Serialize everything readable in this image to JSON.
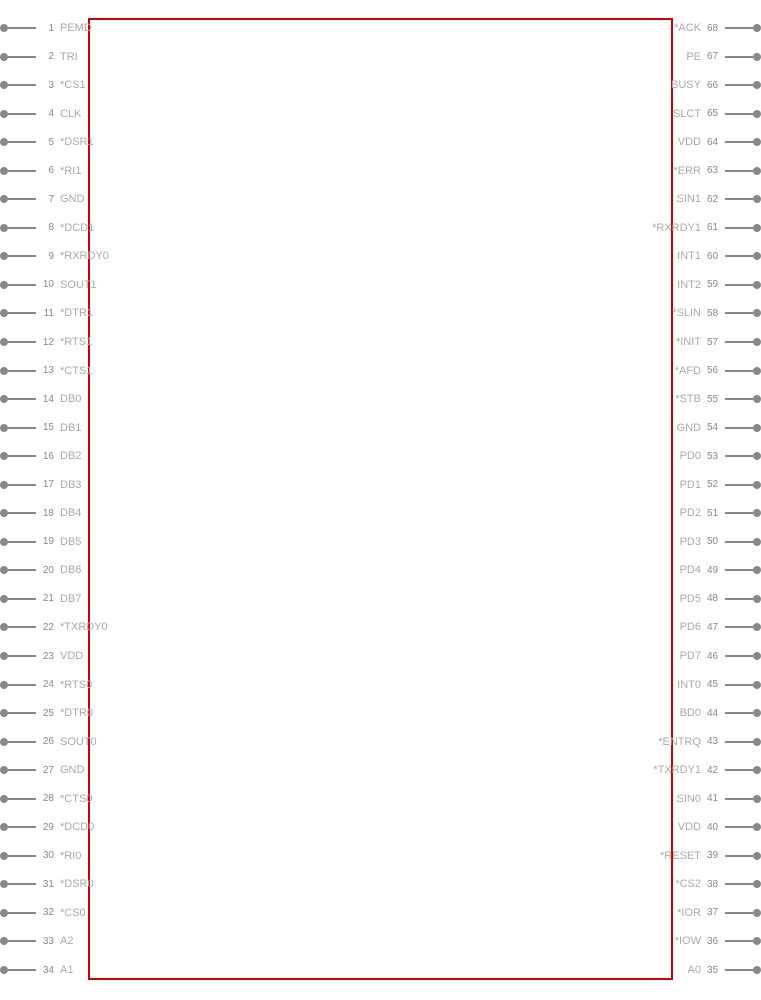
{
  "chip": {
    "left_pins": [
      {
        "num": "1",
        "label": "PEMD"
      },
      {
        "num": "2",
        "label": "TRI"
      },
      {
        "num": "3",
        "label": "*CS1"
      },
      {
        "num": "4",
        "label": "CLK"
      },
      {
        "num": "5",
        "label": "*DSR1"
      },
      {
        "num": "6",
        "label": "*RI1"
      },
      {
        "num": "7",
        "label": "GND"
      },
      {
        "num": "8",
        "label": "*DCD1"
      },
      {
        "num": "9",
        "label": "*RXRDY0"
      },
      {
        "num": "10",
        "label": "SOUT1"
      },
      {
        "num": "11",
        "label": "*DTR1"
      },
      {
        "num": "12",
        "label": "*RTS1"
      },
      {
        "num": "13",
        "label": "*CTS1"
      },
      {
        "num": "14",
        "label": "DB0"
      },
      {
        "num": "15",
        "label": "DB1"
      },
      {
        "num": "16",
        "label": "DB2"
      },
      {
        "num": "17",
        "label": "DB3"
      },
      {
        "num": "18",
        "label": "DB4"
      },
      {
        "num": "19",
        "label": "DB5"
      },
      {
        "num": "20",
        "label": "DB6"
      },
      {
        "num": "21",
        "label": "DB7"
      },
      {
        "num": "22",
        "label": "*TXRDY0"
      },
      {
        "num": "23",
        "label": "VDD"
      },
      {
        "num": "24",
        "label": "*RTS0"
      },
      {
        "num": "25",
        "label": "*DTR0"
      },
      {
        "num": "26",
        "label": "SOUT0"
      },
      {
        "num": "27",
        "label": "GND"
      },
      {
        "num": "28",
        "label": "*CTS0"
      },
      {
        "num": "29",
        "label": "*DCD0"
      },
      {
        "num": "30",
        "label": "*RI0"
      },
      {
        "num": "31",
        "label": "*DSR0"
      },
      {
        "num": "32",
        "label": "*CS0"
      },
      {
        "num": "33",
        "label": "A2"
      },
      {
        "num": "34",
        "label": "A1"
      }
    ],
    "right_pins": [
      {
        "num": "68",
        "label": "*ACK"
      },
      {
        "num": "67",
        "label": "PE"
      },
      {
        "num": "66",
        "label": "BUSY"
      },
      {
        "num": "65",
        "label": "SLCT"
      },
      {
        "num": "64",
        "label": "VDD"
      },
      {
        "num": "63",
        "label": "*ERR"
      },
      {
        "num": "62",
        "label": "SIN1"
      },
      {
        "num": "61",
        "label": "*RXRDY1"
      },
      {
        "num": "60",
        "label": "INT1"
      },
      {
        "num": "59",
        "label": "INT2"
      },
      {
        "num": "58",
        "label": "*SLIN"
      },
      {
        "num": "57",
        "label": "*INIT"
      },
      {
        "num": "56",
        "label": "*AFD"
      },
      {
        "num": "55",
        "label": "*STB"
      },
      {
        "num": "54",
        "label": "GND"
      },
      {
        "num": "53",
        "label": "PD0"
      },
      {
        "num": "52",
        "label": "PD1"
      },
      {
        "num": "51",
        "label": "PD2"
      },
      {
        "num": "50",
        "label": "PD3"
      },
      {
        "num": "49",
        "label": "PD4"
      },
      {
        "num": "48",
        "label": "PD5"
      },
      {
        "num": "47",
        "label": "PD6"
      },
      {
        "num": "46",
        "label": "PD7"
      },
      {
        "num": "45",
        "label": "INT0"
      },
      {
        "num": "44",
        "label": "BD0"
      },
      {
        "num": "43",
        "label": "*ENTRQ"
      },
      {
        "num": "42",
        "label": "*TXRDY1"
      },
      {
        "num": "41",
        "label": "SIN0"
      },
      {
        "num": "40",
        "label": "VDD"
      },
      {
        "num": "39",
        "label": "*RESET"
      },
      {
        "num": "38",
        "label": "*CS2"
      },
      {
        "num": "37",
        "label": "*IOR"
      },
      {
        "num": "36",
        "label": "*IOW"
      },
      {
        "num": "35",
        "label": "A0"
      }
    ]
  }
}
